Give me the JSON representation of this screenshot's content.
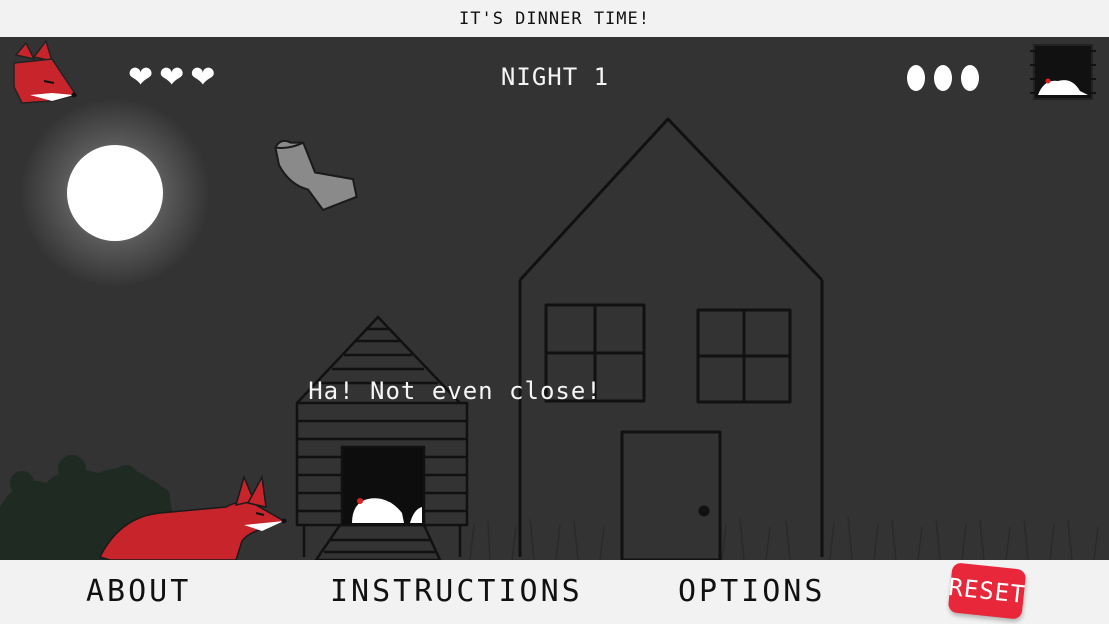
{
  "header": {
    "title": "IT'S DINNER TIME!"
  },
  "hud": {
    "night_label": "NIGHT 1",
    "lives": 3,
    "lives_icon": "heart-icon",
    "eggs": 3,
    "fox_avatar_icon": "fox-head-icon",
    "coop_thumbnail_icon": "coop-thumbnail-icon"
  },
  "scene": {
    "message": "Ha! Not even close!",
    "background_color": "#333333",
    "objects": [
      "moon",
      "thrown-boot",
      "house",
      "chicken-coop",
      "chicken",
      "fox",
      "bushes",
      "grass"
    ]
  },
  "nav": {
    "about": "ABOUT",
    "instructions": "INSTRUCTIONS",
    "options": "OPTIONS",
    "reset": "RESET"
  },
  "colors": {
    "fox_red": "#c8242b",
    "reset_button": "#e8283a",
    "bar_bg": "#f2f2f2"
  }
}
